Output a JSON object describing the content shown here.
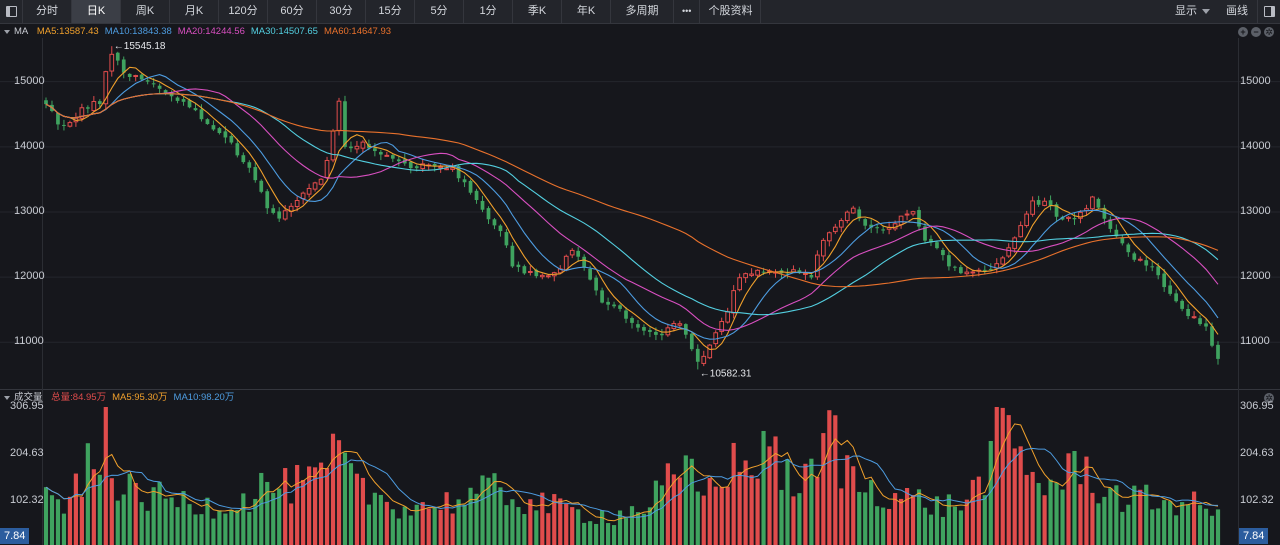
{
  "toolbar": {
    "tabs": [
      {
        "label": "分时",
        "active": false
      },
      {
        "label": "日K",
        "active": true
      },
      {
        "label": "周K",
        "active": false
      },
      {
        "label": "月K",
        "active": false
      },
      {
        "label": "120分",
        "active": false
      },
      {
        "label": "60分",
        "active": false
      },
      {
        "label": "30分",
        "active": false
      },
      {
        "label": "15分",
        "active": false
      },
      {
        "label": "5分",
        "active": false
      },
      {
        "label": "1分",
        "active": false
      },
      {
        "label": "季K",
        "active": false
      },
      {
        "label": "年K",
        "active": false
      },
      {
        "label": "多周期",
        "active": false
      }
    ],
    "more_label": "•••",
    "stock_info_label": "个股资料",
    "display_label": "显示",
    "draw_label": "画线"
  },
  "colors": {
    "up": "#e04c4c",
    "down": "#3fa35f",
    "ma5": "#f0a02c",
    "ma10": "#4d9ce0",
    "ma20": "#d84fc0",
    "ma30": "#53cfe0",
    "ma60": "#e8712c",
    "total": "#e04c4c"
  },
  "chart_data": [
    {
      "type": "candlestick",
      "legend_title": "MA",
      "legend": [
        {
          "name": "MA5",
          "text": "MA5:13587.43",
          "color": "#f0a02c"
        },
        {
          "name": "MA10",
          "text": "MA10:13843.38",
          "color": "#4d9ce0"
        },
        {
          "name": "MA20",
          "text": "MA20:14244.56",
          "color": "#d84fc0"
        },
        {
          "name": "MA30",
          "text": "MA30:14507.65",
          "color": "#53cfe0"
        },
        {
          "name": "MA60",
          "text": "MA60:14647.93",
          "color": "#e8712c"
        }
      ],
      "y_ticks": [
        "15000",
        "14000",
        "13000",
        "12000",
        "11000"
      ],
      "ylim": [
        10420,
        15640
      ],
      "annotations": [
        {
          "text": "←15545.18",
          "value": 15545.18,
          "index": 11
        },
        {
          "text": "←10582.31",
          "value": 10582.31,
          "index": 109
        }
      ],
      "anchors": [
        [
          0,
          14700
        ],
        [
          2,
          14350
        ],
        [
          4,
          14350
        ],
        [
          6,
          14560
        ],
        [
          9,
          14700
        ],
        [
          11,
          15545.18
        ],
        [
          13,
          15150
        ],
        [
          17,
          15000
        ],
        [
          21,
          14800
        ],
        [
          24,
          14600
        ],
        [
          28,
          14300
        ],
        [
          31,
          14050
        ],
        [
          35,
          13500
        ],
        [
          37,
          13100
        ],
        [
          39,
          12900
        ],
        [
          42,
          13200
        ],
        [
          44,
          13350
        ],
        [
          46,
          13500
        ],
        [
          47,
          13750
        ],
        [
          49,
          14700
        ],
        [
          50,
          14000
        ],
        [
          53,
          14050
        ],
        [
          56,
          13900
        ],
        [
          59,
          13750
        ],
        [
          62,
          13700
        ],
        [
          65,
          13750
        ],
        [
          68,
          13650
        ],
        [
          71,
          13300
        ],
        [
          73,
          13000
        ],
        [
          76,
          12700
        ],
        [
          78,
          12200
        ],
        [
          81,
          12050
        ],
        [
          84,
          12050
        ],
        [
          86,
          12150
        ],
        [
          88,
          12450
        ],
        [
          89,
          12300
        ],
        [
          91,
          12000
        ],
        [
          93,
          11600
        ],
        [
          96,
          11500
        ],
        [
          99,
          11200
        ],
        [
          102,
          11100
        ],
        [
          104,
          11200
        ],
        [
          106,
          11300
        ],
        [
          108,
          10900
        ],
        [
          109,
          10582.31
        ],
        [
          111,
          11000
        ],
        [
          114,
          11500
        ],
        [
          116,
          12000
        ],
        [
          119,
          12100
        ],
        [
          122,
          12050
        ],
        [
          125,
          12100
        ],
        [
          128,
          12000
        ],
        [
          130,
          12600
        ],
        [
          133,
          12900
        ],
        [
          135,
          13050
        ],
        [
          137,
          12800
        ],
        [
          140,
          12700
        ],
        [
          143,
          12900
        ],
        [
          145,
          13000
        ],
        [
          147,
          12600
        ],
        [
          149,
          12400
        ],
        [
          151,
          12200
        ],
        [
          154,
          12050
        ],
        [
          157,
          12100
        ],
        [
          160,
          12300
        ],
        [
          163,
          12750
        ],
        [
          165,
          13150
        ],
        [
          167,
          13150
        ],
        [
          170,
          12850
        ],
        [
          173,
          12950
        ],
        [
          175,
          13200
        ],
        [
          177,
          12900
        ],
        [
          179,
          12600
        ],
        [
          182,
          12300
        ],
        [
          185,
          12150
        ],
        [
          188,
          11700
        ],
        [
          190,
          11500
        ],
        [
          192,
          11350
        ],
        [
          194,
          11200
        ],
        [
          196,
          10780
        ]
      ],
      "volume": {
        "legend_title": "成交量",
        "legend": [
          {
            "name": "total",
            "text": "总量:84.95万",
            "color": "#e04c4c"
          },
          {
            "name": "MA5",
            "text": "MA5:95.30万",
            "color": "#f0a02c"
          },
          {
            "name": "MA10",
            "text": "MA10:98.20万",
            "color": "#4d9ce0"
          }
        ],
        "y_ticks": [
          "306.95",
          "204.63",
          "102.32"
        ],
        "ylim": [
          7.84,
          306.95
        ],
        "badge": "7.84",
        "anchors": [
          [
            0,
            110
          ],
          [
            4,
            105
          ],
          [
            7,
            185
          ],
          [
            9,
            160
          ],
          [
            10,
            306.95
          ],
          [
            12,
            140
          ],
          [
            16,
            120
          ],
          [
            20,
            115
          ],
          [
            24,
            105
          ],
          [
            28,
            100
          ],
          [
            33,
            110
          ],
          [
            37,
            150
          ],
          [
            40,
            140
          ],
          [
            45,
            155
          ],
          [
            47,
            170
          ],
          [
            49,
            235
          ],
          [
            51,
            150
          ],
          [
            55,
            120
          ],
          [
            60,
            95
          ],
          [
            65,
            100
          ],
          [
            70,
            115
          ],
          [
            75,
            135
          ],
          [
            80,
            110
          ],
          [
            85,
            95
          ],
          [
            90,
            80
          ],
          [
            95,
            75
          ],
          [
            100,
            95
          ],
          [
            104,
            150
          ],
          [
            108,
            170
          ],
          [
            110,
            120
          ],
          [
            113,
            180
          ],
          [
            116,
            195
          ],
          [
            118,
            170
          ],
          [
            120,
            255
          ],
          [
            123,
            170
          ],
          [
            126,
            150
          ],
          [
            129,
            170
          ],
          [
            131,
            300
          ],
          [
            133,
            190
          ],
          [
            136,
            150
          ],
          [
            140,
            130
          ],
          [
            143,
            120
          ],
          [
            146,
            110
          ],
          [
            150,
            95
          ],
          [
            154,
            110
          ],
          [
            158,
            195
          ],
          [
            160,
            305
          ],
          [
            162,
            230
          ],
          [
            165,
            170
          ],
          [
            168,
            140
          ],
          [
            171,
            170
          ],
          [
            173,
            200
          ],
          [
            176,
            140
          ],
          [
            180,
            115
          ],
          [
            185,
            110
          ],
          [
            190,
            105
          ],
          [
            196,
            90
          ]
        ]
      }
    }
  ]
}
